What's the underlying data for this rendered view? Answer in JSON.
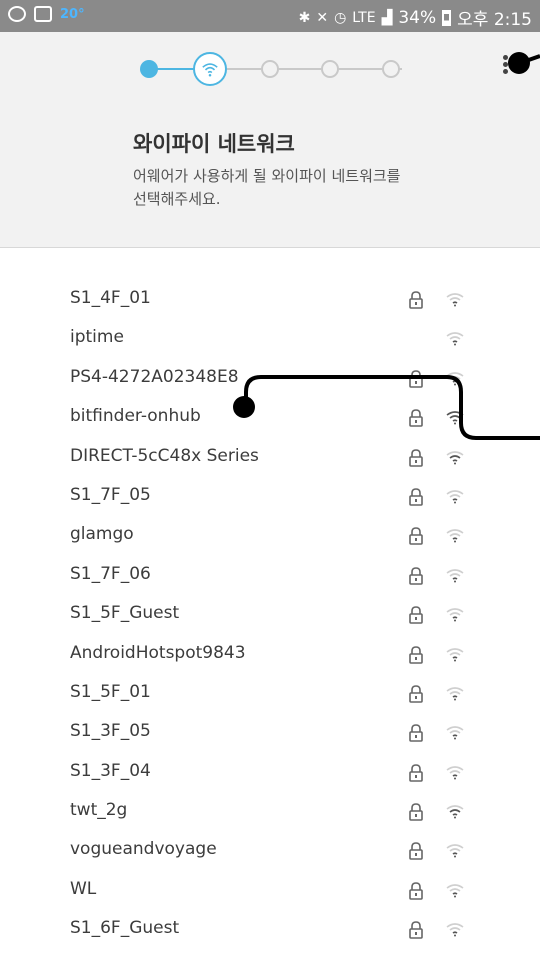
{
  "status_bar": {
    "temperature": "20°",
    "network_type": "LTE",
    "battery": "34%",
    "time": "오후 2:15"
  },
  "setup": {
    "title": "와이파이 네트워크",
    "subtitle": "어웨어가 사용하게 될 와이파이 네트워크를 선택해주세요.",
    "steps": [
      "done",
      "current",
      "todo",
      "todo",
      "todo"
    ]
  },
  "networks": [
    {
      "name": "S1_4F_01",
      "locked": true,
      "signal": "weak"
    },
    {
      "name": "iptime",
      "locked": false,
      "signal": "weak"
    },
    {
      "name": "PS4-4272A02348E8",
      "locked": true,
      "signal": "weak"
    },
    {
      "name": "bitfinder-onhub",
      "locked": true,
      "signal": "strong"
    },
    {
      "name": "DIRECT-5cC48x Series",
      "locked": true,
      "signal": "medium"
    },
    {
      "name": "S1_7F_05",
      "locked": true,
      "signal": "weak"
    },
    {
      "name": "glamgo",
      "locked": true,
      "signal": "weak"
    },
    {
      "name": "S1_7F_06",
      "locked": true,
      "signal": "weak"
    },
    {
      "name": "S1_5F_Guest",
      "locked": true,
      "signal": "weak"
    },
    {
      "name": "AndroidHotspot9843",
      "locked": true,
      "signal": "weak"
    },
    {
      "name": "S1_5F_01",
      "locked": true,
      "signal": "weak"
    },
    {
      "name": "S1_3F_05",
      "locked": true,
      "signal": "weak"
    },
    {
      "name": "S1_3F_04",
      "locked": true,
      "signal": "weak"
    },
    {
      "name": "twt_2g",
      "locked": true,
      "signal": "medium"
    },
    {
      "name": "vogueandvoyage",
      "locked": true,
      "signal": "weak"
    },
    {
      "name": "WL",
      "locked": true,
      "signal": "weak"
    },
    {
      "name": "S1_6F_Guest",
      "locked": true,
      "signal": "weak"
    }
  ],
  "colors": {
    "accent": "#4db6e2",
    "header_bg": "#f2f2f2",
    "status_bar_bg": "#8a8a8a"
  }
}
